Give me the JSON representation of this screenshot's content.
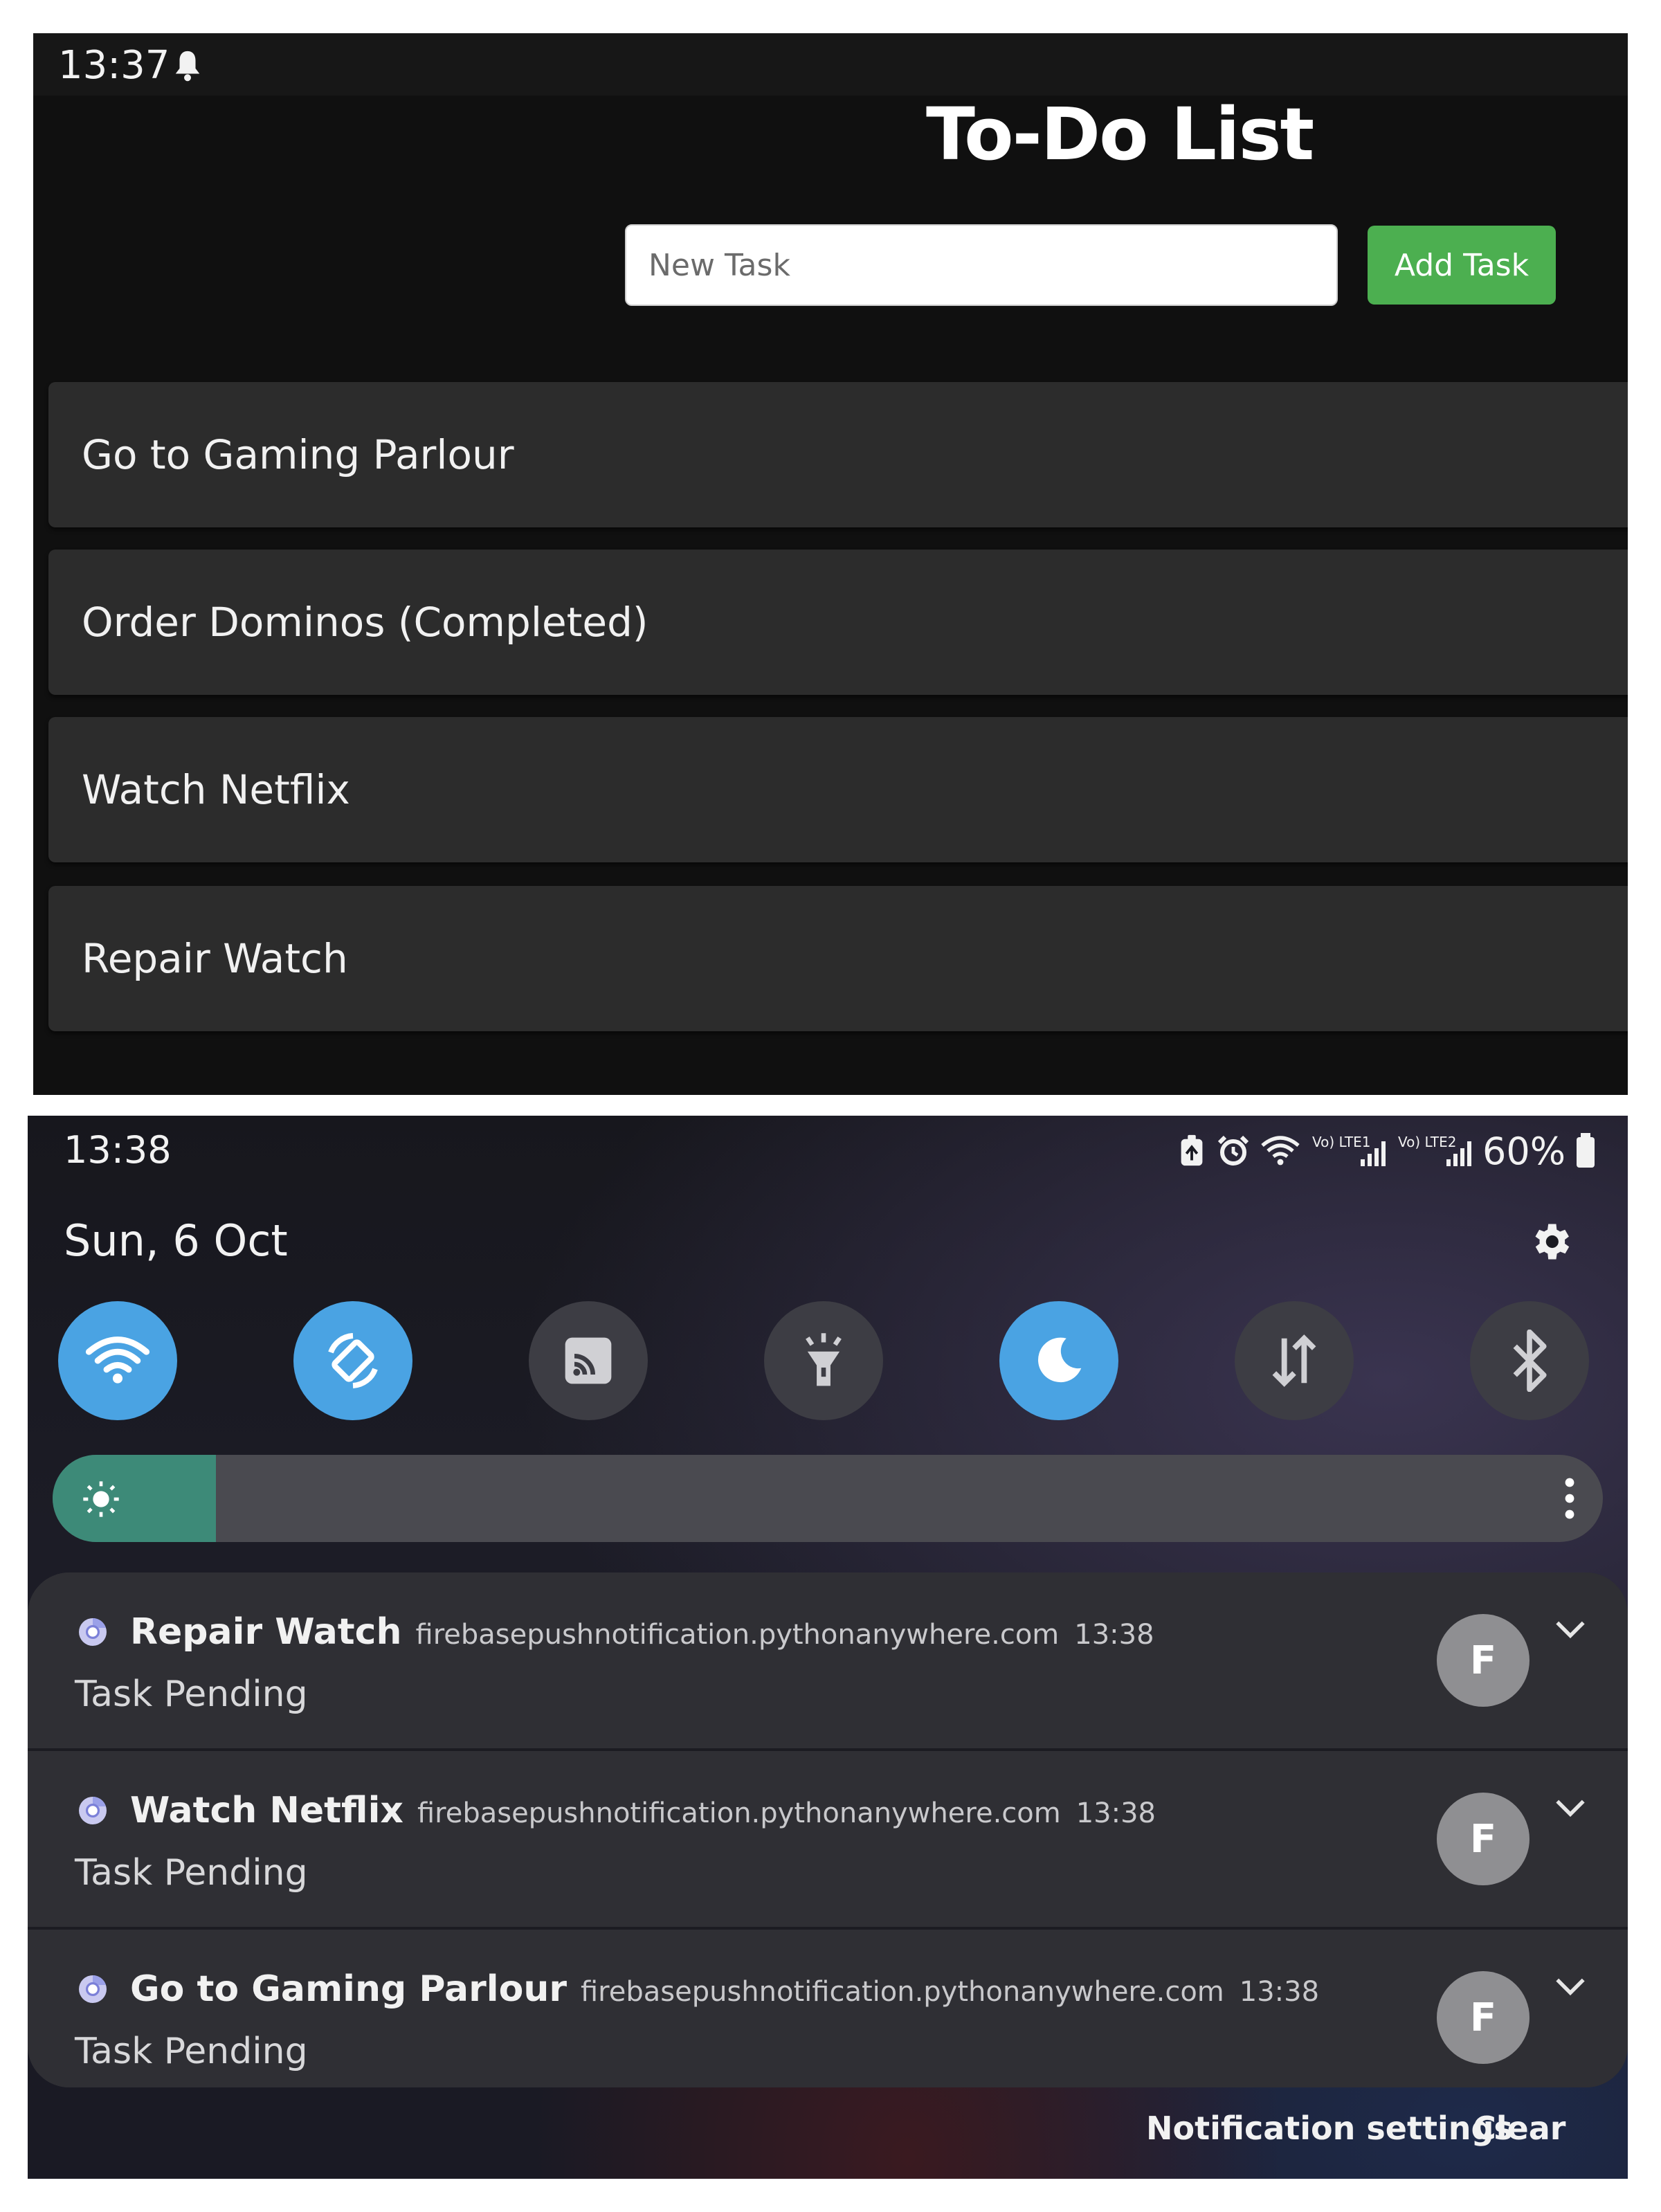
{
  "todo_app": {
    "status_bar": {
      "time": "13:37",
      "icons": [
        "bell-icon"
      ]
    },
    "title": "To-Do List",
    "new_task_placeholder": "New Task",
    "add_task_label": "Add Task",
    "tasks": [
      {
        "label": "Go to Gaming Parlour"
      },
      {
        "label": "Order Dominos (Completed)"
      },
      {
        "label": "Watch Netflix"
      },
      {
        "label": "Repair Watch"
      }
    ]
  },
  "notification_shade": {
    "status_bar": {
      "time": "13:38",
      "icons": [
        "battery-saver-icon",
        "alarm-icon",
        "wifi-icon",
        "lte1-signal-icon",
        "lte2-signal-icon",
        "battery-icon"
      ],
      "lte1_label": "Vo) LTE1",
      "lte2_label": "Vo) LTE2",
      "battery_percent": "60%"
    },
    "date": "Sun, 6 Oct",
    "quick_settings": [
      {
        "name": "wifi",
        "icon": "wifi-icon",
        "active": true
      },
      {
        "name": "auto-rotate",
        "icon": "auto-rotate-icon",
        "active": true
      },
      {
        "name": "cast",
        "icon": "cast-icon",
        "active": false
      },
      {
        "name": "flashlight",
        "icon": "flashlight-icon",
        "active": false
      },
      {
        "name": "dark-mode",
        "icon": "moon-icon",
        "active": true
      },
      {
        "name": "mobile-data",
        "icon": "data-transfer-icon",
        "active": false
      },
      {
        "name": "bluetooth",
        "icon": "bluetooth-icon",
        "active": false
      }
    ],
    "brightness_level": 0.05,
    "notifications": [
      {
        "title": "Repair Watch",
        "domain": "firebasepushnotification.pythonanywhere.com",
        "time": "13:38",
        "body": "Task Pending",
        "avatar": "F"
      },
      {
        "title": "Watch Netflix",
        "domain": "firebasepushnotification.pythonanywhere.com",
        "time": "13:38",
        "body": "Task Pending",
        "avatar": "F"
      },
      {
        "title": "Go to Gaming Parlour",
        "domain": "firebasepushnotification.pythonanywhere.com",
        "time": "13:38",
        "body": "Task Pending",
        "avatar": "F"
      }
    ],
    "footer": {
      "notification_settings_label": "Notification settings",
      "clear_label": "Clear"
    }
  },
  "colors": {
    "todo_background": "#101010",
    "task_item_background": "#2c2c2c",
    "add_button_green": "#4caf50",
    "qs_active_blue": "#4aa3e3",
    "brightness_teal": "#3d8a78"
  }
}
